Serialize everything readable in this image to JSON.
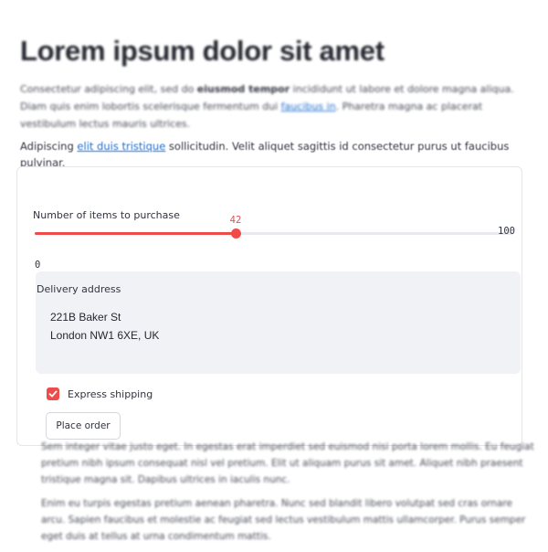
{
  "header": {
    "title": "Lorem ipsum dolor sit amet"
  },
  "intro": {
    "p1_a": "Consectetur adipiscing elit, sed do ",
    "p1_bold": "eiusmod tempor",
    "p1_b": " incididunt ut labore et dolore magna aliqua. Diam quis enim lobortis scelerisque fermentum dui ",
    "p1_link": "faucibus in",
    "p1_c": ". Pharetra magna ac placerat vestibulum lectus mauris ultrices.",
    "p2_a": "Adipiscing ",
    "p2_link": "elit duis tristique",
    "p2_b": " sollicitudin. Velit aliquet sagittis id consectetur purus ut faucibus pulvinar."
  },
  "form": {
    "slider": {
      "label": "Number of items to purchase",
      "value": 42,
      "value_text": "42",
      "min_text": "0",
      "max_text": "100",
      "fraction": 0.42
    },
    "address": {
      "label": "Delivery address",
      "value": "221B Baker St\nLondon NW1 6XE, UK"
    },
    "express": {
      "label": "Express shipping",
      "checked": true
    },
    "submit_label": "Place order"
  },
  "outro": {
    "p1": "Sem integer vitae justo eget. In egestas erat imperdiet sed euismod nisi porta lorem mollis. Eu feugiat pretium nibh ipsum consequat nisl vel pretium. Elit ut aliquam purus sit amet. Aliquet nibh praesent tristique magna sit. Dapibus ultrices in iaculis nunc.",
    "p2": "Enim eu turpis egestas pretium aenean pharetra. Nunc sed blandit libero volutpat sed cras ornare arcu. Sapien faucibus et molestie ac feugiat sed lectus vestibulum mattis ullamcorper. Purus semper eget duis at tellus at urna condimentum mattis."
  },
  "colors": {
    "accent": "#ef4b4b",
    "link": "#1f6fd0",
    "input_bg": "#f0f2f6"
  }
}
